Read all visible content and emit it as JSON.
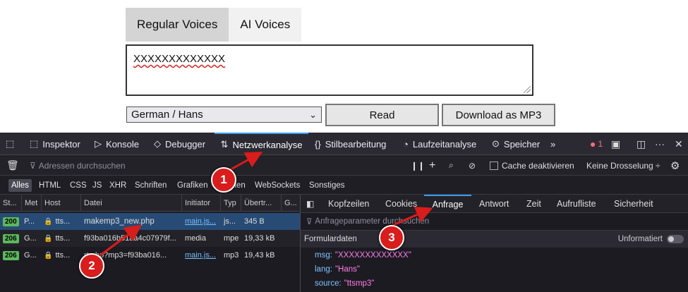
{
  "page": {
    "tabs": [
      "Regular Voices",
      "AI Voices"
    ],
    "textarea_value": "XXXXXXXXXXXXX",
    "voice_select": "German / Hans",
    "read_button": "Read",
    "download_button": "Download as MP3"
  },
  "devtools": {
    "tools": [
      "Inspektor",
      "Konsole",
      "Debugger",
      "Netzwerkanalyse",
      "Stilbearbeitung",
      "Laufzeitanalyse",
      "Speicher"
    ],
    "active_tool": "Netzwerkanalyse",
    "error_count": "1",
    "filter_placeholder": "Adressen durchsuchen",
    "cache_label": "Cache deaktivieren",
    "throttle_label": "Keine Drosselung ÷",
    "types": [
      "Alles",
      "HTML",
      "CSS",
      "JS",
      "XHR",
      "Schriften",
      "Grafiken",
      "Medien",
      "WebSockets",
      "Sonstiges"
    ],
    "columns": [
      "St...",
      "Met",
      "Host",
      "Datei",
      "Initiator",
      "Typ",
      "Übertr...",
      "G..."
    ],
    "rows": [
      {
        "status": "200",
        "method": "P...",
        "host": "tts...",
        "file": "makemp3_new.php",
        "initiator": "main.js...",
        "type": "js...",
        "transferred": "345 B"
      },
      {
        "status": "206",
        "method": "G...",
        "host": "tts...",
        "file": "f93ba016b51aa4c07979f...",
        "initiator": "media",
        "type": "mpe",
        "transferred": "19,33 kB"
      },
      {
        "status": "206",
        "method": "G...",
        "host": "tts...",
        "file": "rt.php?mp3=f93ba016...",
        "initiator": "main.js...",
        "type": "mp3",
        "transferred": "19,43 kB"
      }
    ],
    "detail_tabs": [
      "Kopfzeilen",
      "Cookies",
      "Anfrage",
      "Antwort",
      "Zeit",
      "Aufrufliste",
      "Sicherheit"
    ],
    "active_detail_tab": "Anfrage",
    "params_placeholder": "Anfrageparameter durchsuchen",
    "form_header": "Formulardaten",
    "raw_label": "Unformatiert",
    "params": [
      {
        "key": "msg:",
        "value": "\"XXXXXXXXXXXXX\""
      },
      {
        "key": "lang:",
        "value": "\"Hans\""
      },
      {
        "key": "source:",
        "value": "\"ttsmp3\""
      }
    ]
  },
  "callouts": [
    "1",
    "2",
    "3"
  ],
  "colors": {
    "accent": "#3b9cf0",
    "callout": "#d91c1c",
    "status_ok": "#5cb85c",
    "param_value": "#ff7de9"
  }
}
